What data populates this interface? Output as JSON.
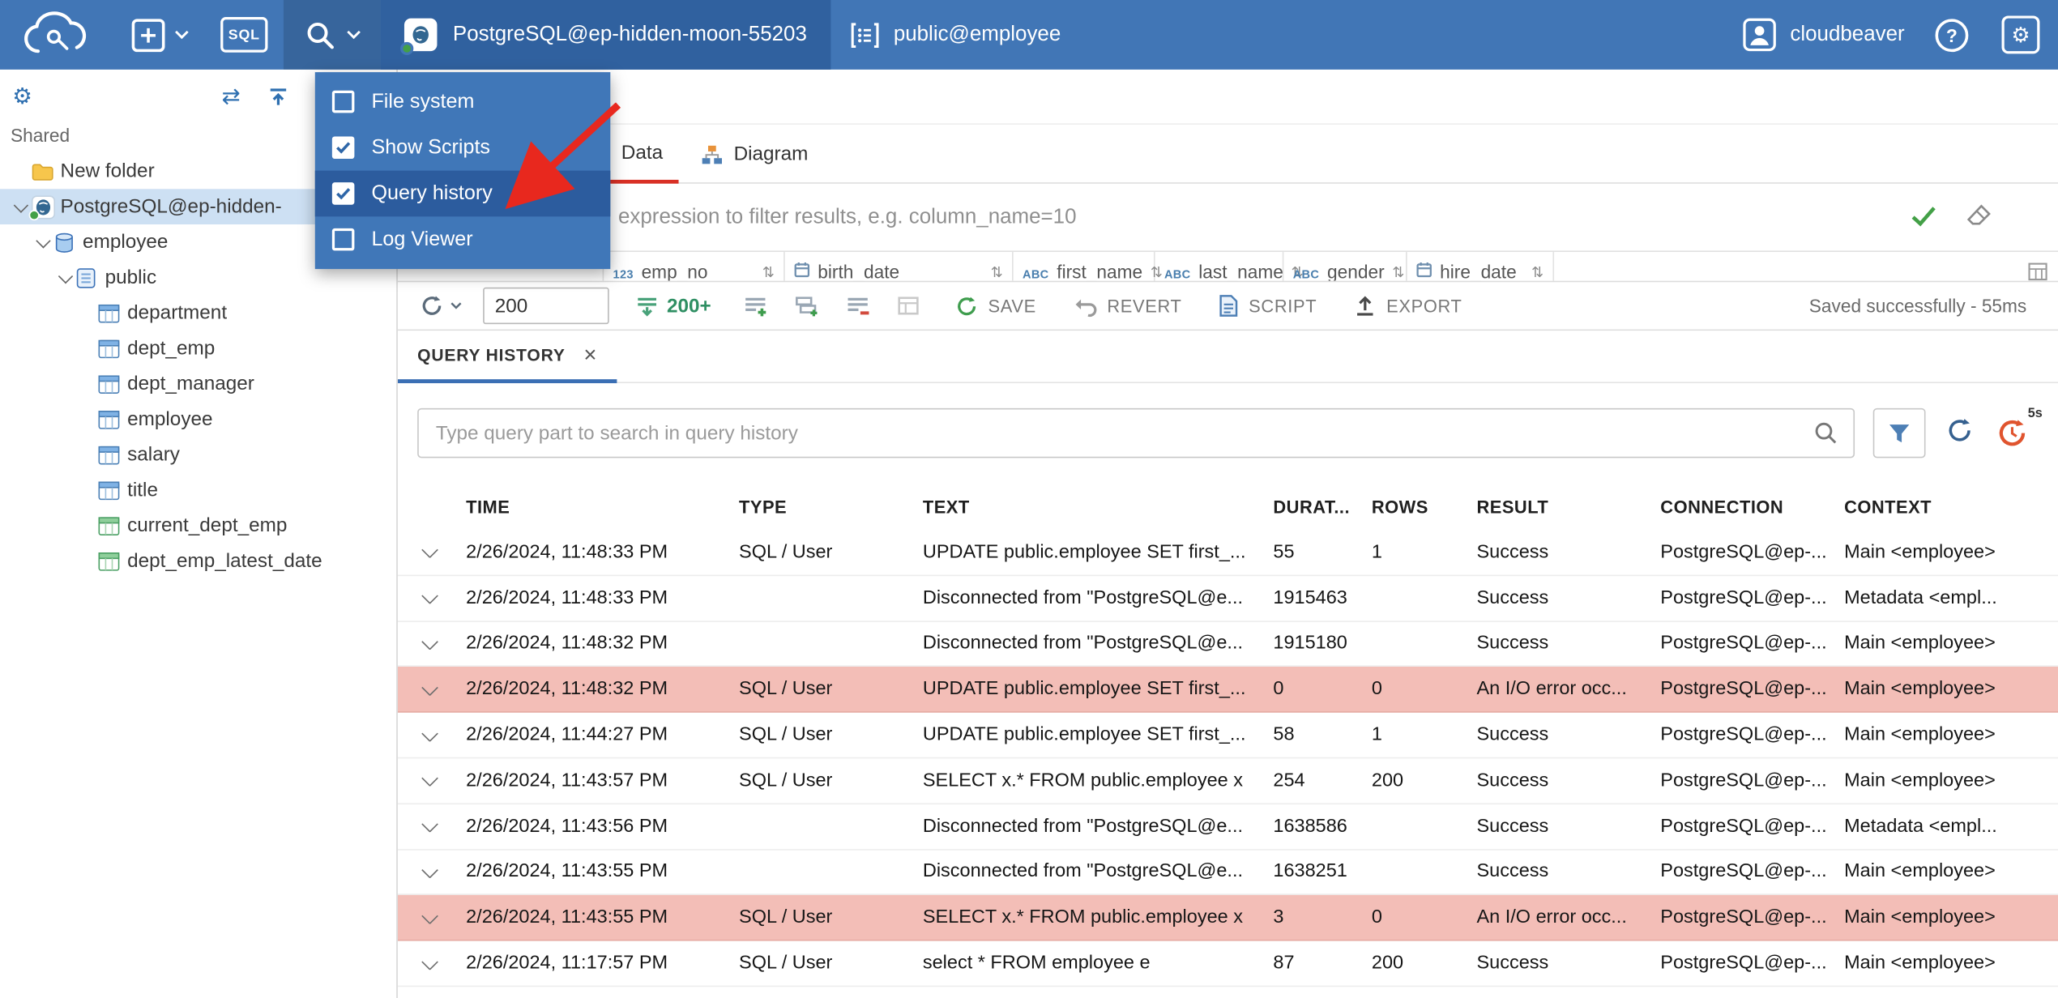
{
  "topbar": {
    "sql_label": "SQL",
    "connection_label": "PostgreSQL@ep-hidden-moon-55203",
    "schema_label": "public@employee",
    "user_label": "cloudbeaver",
    "help_label": "?"
  },
  "menu": {
    "items": [
      {
        "label": "File system",
        "checked": false,
        "selected": false
      },
      {
        "label": "Show Scripts",
        "checked": true,
        "selected": false
      },
      {
        "label": "Query history",
        "checked": true,
        "selected": true
      },
      {
        "label": "Log Viewer",
        "checked": false,
        "selected": false
      }
    ]
  },
  "sidebar": {
    "section_label": "Shared",
    "tree": [
      {
        "label": "New folder",
        "icon": "folder-icon",
        "level": 0,
        "expandable": false,
        "selected": false
      },
      {
        "label": "PostgreSQL@ep-hidden-",
        "icon": "postgres-icon",
        "level": 0,
        "expandable": true,
        "selected": true
      },
      {
        "label": "employee",
        "icon": "database-icon",
        "level": 1,
        "expandable": true,
        "selected": false
      },
      {
        "label": "public",
        "icon": "schema-icon",
        "level": 2,
        "expandable": true,
        "selected": false
      },
      {
        "label": "department",
        "icon": "table-icon",
        "level": 3,
        "expandable": false,
        "selected": false
      },
      {
        "label": "dept_emp",
        "icon": "table-icon",
        "level": 3,
        "expandable": false,
        "selected": false
      },
      {
        "label": "dept_manager",
        "icon": "table-icon",
        "level": 3,
        "expandable": false,
        "selected": false
      },
      {
        "label": "employee",
        "icon": "table-icon",
        "level": 3,
        "expandable": false,
        "selected": false
      },
      {
        "label": "salary",
        "icon": "table-icon",
        "level": 3,
        "expandable": false,
        "selected": false
      },
      {
        "label": "title",
        "icon": "table-icon",
        "level": 3,
        "expandable": false,
        "selected": false
      },
      {
        "label": "current_dept_emp",
        "icon": "view-icon",
        "level": 3,
        "expandable": false,
        "selected": false
      },
      {
        "label": "dept_emp_latest_date",
        "icon": "view-icon",
        "level": 3,
        "expandable": false,
        "selected": false
      }
    ]
  },
  "tabs": {
    "data_label": "Data",
    "diagram_label": "Diagram"
  },
  "filter": {
    "placeholder": "expression to filter results, e.g. column_name=10"
  },
  "grid": {
    "columns": [
      {
        "name": "emp_no",
        "type": "number"
      },
      {
        "name": "birth_date",
        "type": "date"
      },
      {
        "name": "first_name",
        "type": "string"
      },
      {
        "name": "last_name",
        "type": "string"
      },
      {
        "name": "gender",
        "type": "string"
      },
      {
        "name": "hire_date",
        "type": "date"
      }
    ]
  },
  "result_toolbar": {
    "row_limit": "200",
    "fetch_label": "200+",
    "save_label": "SAVE",
    "revert_label": "REVERT",
    "script_label": "SCRIPT",
    "export_label": "EXPORT",
    "status": "Saved successfully - 55ms"
  },
  "history": {
    "tab_label": "QUERY HISTORY",
    "search_placeholder": "Type query part to search in query history",
    "auto_refresh_label": "5s",
    "columns": [
      "TIME",
      "TYPE",
      "TEXT",
      "DURAT...",
      "ROWS",
      "RESULT",
      "CONNECTION",
      "CONTEXT"
    ],
    "rows": [
      {
        "time": "2/26/2024, 11:48:33 PM",
        "type": "SQL / User",
        "text": "UPDATE public.employee SET first_...",
        "duration": "55",
        "rows": "1",
        "result": "Success",
        "connection": "PostgreSQL@ep-...",
        "context": "Main <employee>",
        "error": false
      },
      {
        "time": "2/26/2024, 11:48:33 PM",
        "type": "",
        "text": "Disconnected from \"PostgreSQL@e...",
        "duration": "1915463",
        "rows": "",
        "result": "Success",
        "connection": "PostgreSQL@ep-...",
        "context": "Metadata <empl...",
        "error": false
      },
      {
        "time": "2/26/2024, 11:48:32 PM",
        "type": "",
        "text": "Disconnected from \"PostgreSQL@e...",
        "duration": "1915180",
        "rows": "",
        "result": "Success",
        "connection": "PostgreSQL@ep-...",
        "context": "Main <employee>",
        "error": false
      },
      {
        "time": "2/26/2024, 11:48:32 PM",
        "type": "SQL / User",
        "text": "UPDATE public.employee SET first_...",
        "duration": "0",
        "rows": "0",
        "result": "An I/O error occ...",
        "connection": "PostgreSQL@ep-...",
        "context": "Main <employee>",
        "error": true
      },
      {
        "time": "2/26/2024, 11:44:27 PM",
        "type": "SQL / User",
        "text": "UPDATE public.employee SET first_...",
        "duration": "58",
        "rows": "1",
        "result": "Success",
        "connection": "PostgreSQL@ep-...",
        "context": "Main <employee>",
        "error": false
      },
      {
        "time": "2/26/2024, 11:43:57 PM",
        "type": "SQL / User",
        "text": "SELECT x.* FROM public.employee x",
        "duration": "254",
        "rows": "200",
        "result": "Success",
        "connection": "PostgreSQL@ep-...",
        "context": "Main <employee>",
        "error": false
      },
      {
        "time": "2/26/2024, 11:43:56 PM",
        "type": "",
        "text": "Disconnected from \"PostgreSQL@e...",
        "duration": "1638586",
        "rows": "",
        "result": "Success",
        "connection": "PostgreSQL@ep-...",
        "context": "Metadata <empl...",
        "error": false
      },
      {
        "time": "2/26/2024, 11:43:55 PM",
        "type": "",
        "text": "Disconnected from \"PostgreSQL@e...",
        "duration": "1638251",
        "rows": "",
        "result": "Success",
        "connection": "PostgreSQL@ep-...",
        "context": "Main <employee>",
        "error": false
      },
      {
        "time": "2/26/2024, 11:43:55 PM",
        "type": "SQL / User",
        "text": "SELECT x.* FROM public.employee x",
        "duration": "3",
        "rows": "0",
        "result": "An I/O error occ...",
        "connection": "PostgreSQL@ep-...",
        "context": "Main <employee>",
        "error": true
      },
      {
        "time": "2/26/2024, 11:17:57 PM",
        "type": "SQL / User",
        "text": "select * FROM employee e",
        "duration": "87",
        "rows": "200",
        "result": "Success",
        "connection": "PostgreSQL@ep-...",
        "context": "Main <employee>",
        "error": false
      }
    ]
  }
}
